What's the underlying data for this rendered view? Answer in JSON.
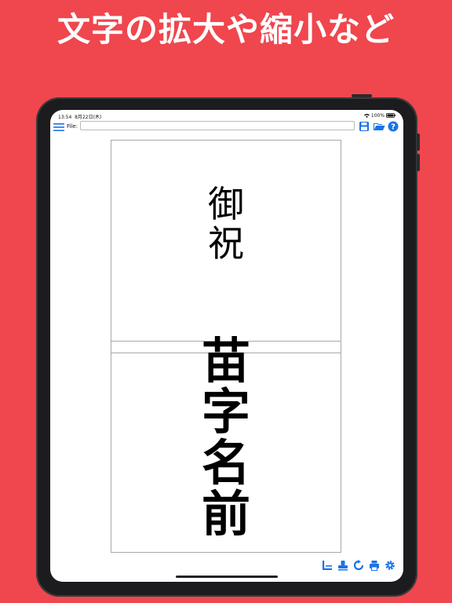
{
  "headline": "文字の拡大や縮小など",
  "status_bar": {
    "time": "13:54",
    "date": "8月22日(木)",
    "battery": "100%"
  },
  "toolbar": {
    "file_label": "File:",
    "file_value": "",
    "icons": [
      "menu-icon",
      "save-icon",
      "folder-open-icon",
      "help-icon"
    ]
  },
  "document": {
    "top_text": [
      "御",
      "祝"
    ],
    "main_text": [
      "苗",
      "字",
      "名",
      "前"
    ]
  },
  "bottom_tools": {
    "icons": [
      "layout-icon",
      "stamp-icon",
      "rotate-icon",
      "print-icon",
      "gear-icon"
    ]
  },
  "colors": {
    "background": "#f0464e",
    "accent": "#1a73e8",
    "tablet": "#1c1c1e"
  }
}
